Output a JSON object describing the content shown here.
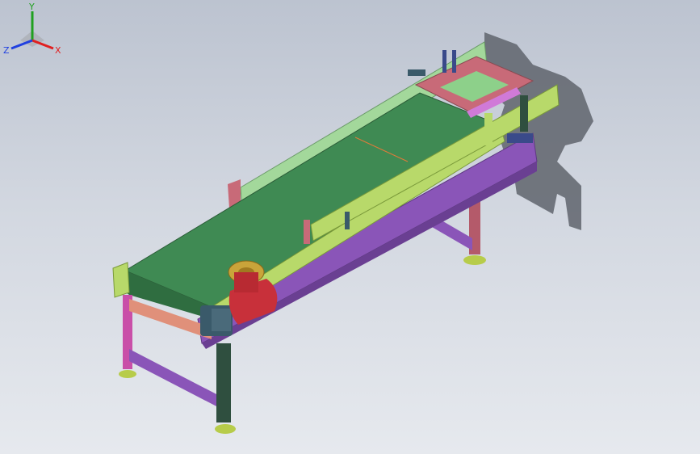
{
  "colors": {
    "belt": "#3f8a53",
    "belt_dark": "#2f6d40",
    "side_rail": "#b8d96a",
    "side_rail_dark": "#8fb04a",
    "frame": "#8a55b8",
    "frame_dark": "#6a3f92",
    "leg": "#c94fa8",
    "leg_dark": "#2f4f3f",
    "guard": "#8dd08a",
    "bracket": "#c86a78",
    "motor": "#c8303a",
    "motor_cap": "#c9a43a",
    "shadow": "#5a5f68",
    "foot": "#b7cc4a",
    "axis_x": "#e02020",
    "axis_y": "#20a020",
    "axis_z": "#2040e0"
  },
  "triad": {
    "x_label": "X",
    "y_label": "Y",
    "z_label": "Z"
  },
  "icons": {
    "triad": "coordinate-triad-icon"
  }
}
